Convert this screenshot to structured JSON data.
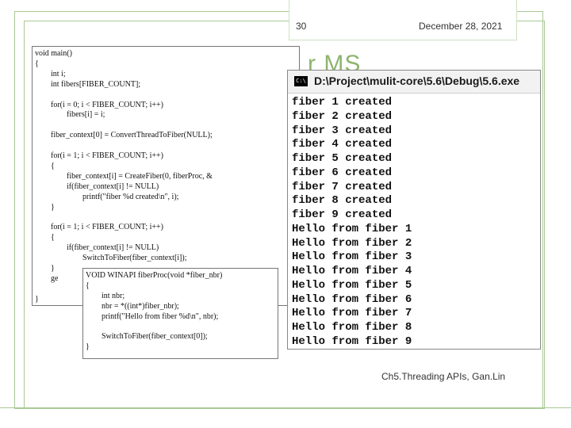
{
  "slide": {
    "number": "30",
    "date": "December 28, 2021",
    "title_partial": "r MS",
    "footer": "Ch5.Threading APIs, Gan.Lin"
  },
  "main_code": [
    "void main()",
    "{",
    "        int i;",
    "        int fibers[FIBER_COUNT];",
    "",
    "        for(i = 0; i < FIBER_COUNT; i++)",
    "                fibers[i] = i;",
    "",
    "        fiber_context[0] = ConvertThreadToFiber(NULL);",
    "",
    "        for(i = 1; i < FIBER_COUNT; i++)",
    "        {",
    "                fiber_context[i] = CreateFiber(0, fiberProc, &",
    "                if(fiber_context[i] != NULL)",
    "                        printf(\"fiber %d created\\n\", i);",
    "        }",
    "",
    "        for(i = 1; i < FIBER_COUNT; i++)",
    "        {",
    "                if(fiber_context[i] != NULL)",
    "                        SwitchToFiber(fiber_context[i]);",
    "        }",
    "        ge",
    "",
    "}"
  ],
  "proc_code": [
    "VOID WINAPI fiberProc(void *fiber_nbr)",
    "{",
    "        int nbr;",
    "        nbr = *((int*)fiber_nbr);",
    "        printf(\"Hello from fiber %d\\n\", nbr);",
    "",
    "        SwitchToFiber(fiber_context[0]);",
    "}"
  ],
  "console": {
    "icon_label": "C:\\",
    "title": "D:\\Project\\mulit-core\\5.6\\Debug\\5.6.exe",
    "lines": [
      "fiber 1 created",
      "fiber 2 created",
      "fiber 3 created",
      "fiber 4 created",
      "fiber 5 created",
      "fiber 6 created",
      "fiber 7 created",
      "fiber 8 created",
      "fiber 9 created",
      "Hello from fiber 1",
      "Hello from fiber 2",
      "Hello from fiber 3",
      "Hello from fiber 4",
      "Hello from fiber 5",
      "Hello from fiber 6",
      "Hello from fiber 7",
      "Hello from fiber 8",
      "Hello from fiber 9"
    ]
  }
}
